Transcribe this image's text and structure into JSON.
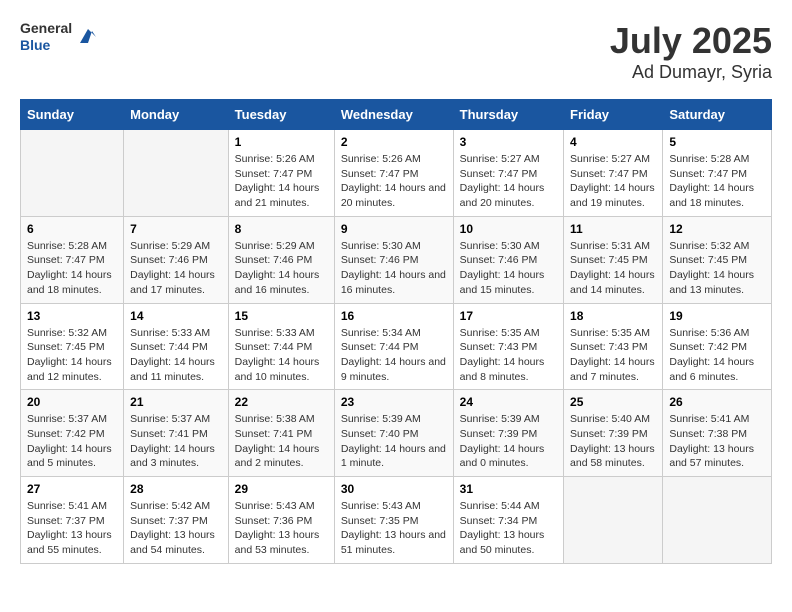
{
  "logo": {
    "general": "General",
    "blue": "Blue"
  },
  "title": "July 2025",
  "subtitle": "Ad Dumayr, Syria",
  "days_of_week": [
    "Sunday",
    "Monday",
    "Tuesday",
    "Wednesday",
    "Thursday",
    "Friday",
    "Saturday"
  ],
  "weeks": [
    [
      {
        "day": "",
        "info": ""
      },
      {
        "day": "",
        "info": ""
      },
      {
        "day": "1",
        "info": "Sunrise: 5:26 AM\nSunset: 7:47 PM\nDaylight: 14 hours and 21 minutes."
      },
      {
        "day": "2",
        "info": "Sunrise: 5:26 AM\nSunset: 7:47 PM\nDaylight: 14 hours and 20 minutes."
      },
      {
        "day": "3",
        "info": "Sunrise: 5:27 AM\nSunset: 7:47 PM\nDaylight: 14 hours and 20 minutes."
      },
      {
        "day": "4",
        "info": "Sunrise: 5:27 AM\nSunset: 7:47 PM\nDaylight: 14 hours and 19 minutes."
      },
      {
        "day": "5",
        "info": "Sunrise: 5:28 AM\nSunset: 7:47 PM\nDaylight: 14 hours and 18 minutes."
      }
    ],
    [
      {
        "day": "6",
        "info": "Sunrise: 5:28 AM\nSunset: 7:47 PM\nDaylight: 14 hours and 18 minutes."
      },
      {
        "day": "7",
        "info": "Sunrise: 5:29 AM\nSunset: 7:46 PM\nDaylight: 14 hours and 17 minutes."
      },
      {
        "day": "8",
        "info": "Sunrise: 5:29 AM\nSunset: 7:46 PM\nDaylight: 14 hours and 16 minutes."
      },
      {
        "day": "9",
        "info": "Sunrise: 5:30 AM\nSunset: 7:46 PM\nDaylight: 14 hours and 16 minutes."
      },
      {
        "day": "10",
        "info": "Sunrise: 5:30 AM\nSunset: 7:46 PM\nDaylight: 14 hours and 15 minutes."
      },
      {
        "day": "11",
        "info": "Sunrise: 5:31 AM\nSunset: 7:45 PM\nDaylight: 14 hours and 14 minutes."
      },
      {
        "day": "12",
        "info": "Sunrise: 5:32 AM\nSunset: 7:45 PM\nDaylight: 14 hours and 13 minutes."
      }
    ],
    [
      {
        "day": "13",
        "info": "Sunrise: 5:32 AM\nSunset: 7:45 PM\nDaylight: 14 hours and 12 minutes."
      },
      {
        "day": "14",
        "info": "Sunrise: 5:33 AM\nSunset: 7:44 PM\nDaylight: 14 hours and 11 minutes."
      },
      {
        "day": "15",
        "info": "Sunrise: 5:33 AM\nSunset: 7:44 PM\nDaylight: 14 hours and 10 minutes."
      },
      {
        "day": "16",
        "info": "Sunrise: 5:34 AM\nSunset: 7:44 PM\nDaylight: 14 hours and 9 minutes."
      },
      {
        "day": "17",
        "info": "Sunrise: 5:35 AM\nSunset: 7:43 PM\nDaylight: 14 hours and 8 minutes."
      },
      {
        "day": "18",
        "info": "Sunrise: 5:35 AM\nSunset: 7:43 PM\nDaylight: 14 hours and 7 minutes."
      },
      {
        "day": "19",
        "info": "Sunrise: 5:36 AM\nSunset: 7:42 PM\nDaylight: 14 hours and 6 minutes."
      }
    ],
    [
      {
        "day": "20",
        "info": "Sunrise: 5:37 AM\nSunset: 7:42 PM\nDaylight: 14 hours and 5 minutes."
      },
      {
        "day": "21",
        "info": "Sunrise: 5:37 AM\nSunset: 7:41 PM\nDaylight: 14 hours and 3 minutes."
      },
      {
        "day": "22",
        "info": "Sunrise: 5:38 AM\nSunset: 7:41 PM\nDaylight: 14 hours and 2 minutes."
      },
      {
        "day": "23",
        "info": "Sunrise: 5:39 AM\nSunset: 7:40 PM\nDaylight: 14 hours and 1 minute."
      },
      {
        "day": "24",
        "info": "Sunrise: 5:39 AM\nSunset: 7:39 PM\nDaylight: 14 hours and 0 minutes."
      },
      {
        "day": "25",
        "info": "Sunrise: 5:40 AM\nSunset: 7:39 PM\nDaylight: 13 hours and 58 minutes."
      },
      {
        "day": "26",
        "info": "Sunrise: 5:41 AM\nSunset: 7:38 PM\nDaylight: 13 hours and 57 minutes."
      }
    ],
    [
      {
        "day": "27",
        "info": "Sunrise: 5:41 AM\nSunset: 7:37 PM\nDaylight: 13 hours and 55 minutes."
      },
      {
        "day": "28",
        "info": "Sunrise: 5:42 AM\nSunset: 7:37 PM\nDaylight: 13 hours and 54 minutes."
      },
      {
        "day": "29",
        "info": "Sunrise: 5:43 AM\nSunset: 7:36 PM\nDaylight: 13 hours and 53 minutes."
      },
      {
        "day": "30",
        "info": "Sunrise: 5:43 AM\nSunset: 7:35 PM\nDaylight: 13 hours and 51 minutes."
      },
      {
        "day": "31",
        "info": "Sunrise: 5:44 AM\nSunset: 7:34 PM\nDaylight: 13 hours and 50 minutes."
      },
      {
        "day": "",
        "info": ""
      },
      {
        "day": "",
        "info": ""
      }
    ]
  ]
}
